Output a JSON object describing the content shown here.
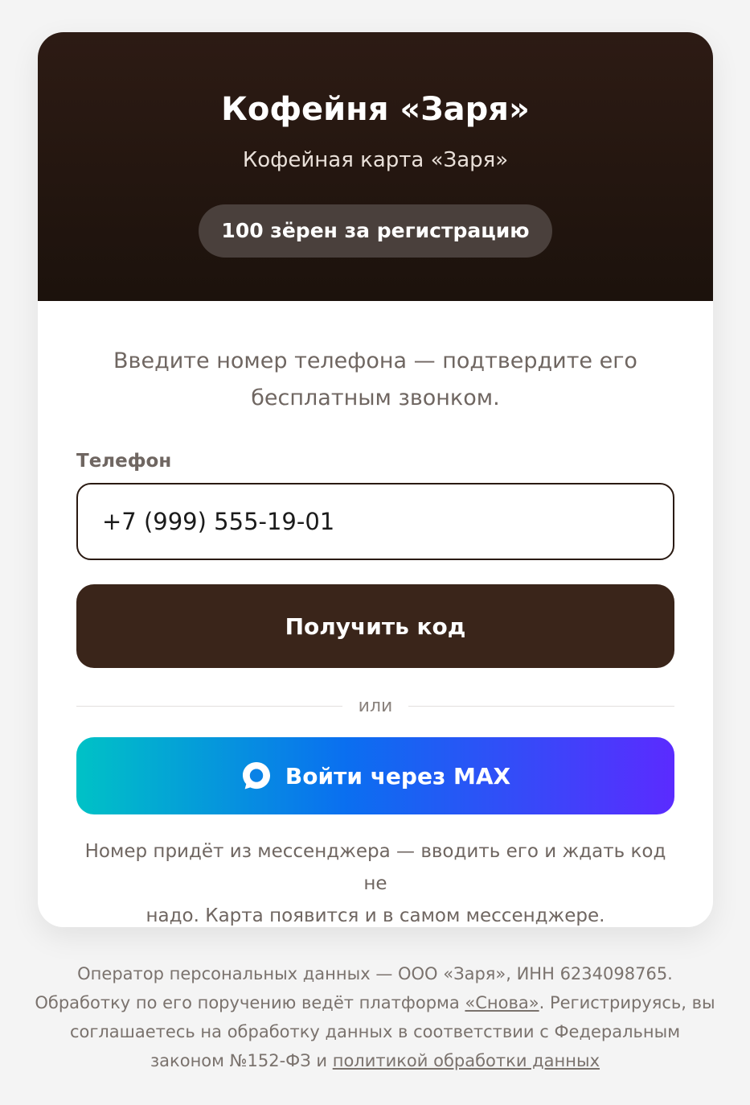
{
  "header": {
    "title": "Кофейня «Заря»",
    "subtitle": "Кофейная карта «Заря»",
    "bonus_badge": "100 зёрен за регистрацию"
  },
  "form": {
    "intro_line1": "Введите номер телефона — подтвердите его",
    "intro_line2": "бесплатным звонком.",
    "phone_label": "Телефон",
    "phone_value": "+7 (999) 555-19-01",
    "submit_label": "Получить код",
    "divider_text": "или",
    "max_button_label": "Войти через MAX",
    "max_icon": "max-messenger-icon",
    "hint_line1": "Номер придёт из мессенджера — вводить его и ждать код не",
    "hint_line2": "надо. Карта появится и в самом мессенджере."
  },
  "footer": {
    "line1": "Оператор персональных данных — ООО «Заря», ИНН 6234098765.",
    "line2_prefix": "Обработку по его поручению ведёт платформа ",
    "platform_link": "«Снова»",
    "line2_suffix": ". Регистрируясь, вы",
    "line3": "соглашаетесь на обработку данных в соответствии с Федеральным",
    "line4_prefix": "законом №152-ФЗ и ",
    "policy_link": "политикой обработки данных"
  },
  "colors": {
    "header_bg": "#2d1b14",
    "primary_button": "#3a251a",
    "page_bg": "#f4f4f4",
    "max_gradient_start": "#00c2c6",
    "max_gradient_end": "#5b2bff"
  }
}
